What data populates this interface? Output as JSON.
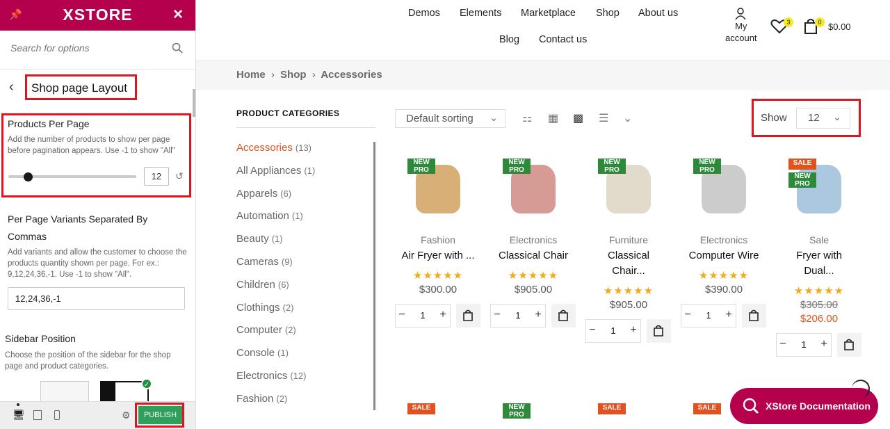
{
  "panel": {
    "logo": "XSTORE",
    "search_placeholder": "Search for options",
    "section_title": "Shop page Layout",
    "products_per_page": {
      "label": "Products Per Page",
      "desc1": "Add the number of products to show per page",
      "desc2": "before pagination appears. Use -1 to show \"All\"",
      "value": "12",
      "slider_fraction": 0.15
    },
    "variants": {
      "label1": "Per Page Variants Separated By",
      "label2": "Commas",
      "desc1": "Add variants and allow the customer to choose the",
      "desc2": "products quantity shown per page. For ex.:",
      "desc3": "9,12,24,36,-1. Use -1 to show \"All\".",
      "value": "12,24,36,-1"
    },
    "sidebar_position": {
      "label": "Sidebar Position",
      "desc1": "Choose the position of the sidebar for the shop",
      "desc2": "page and product categories."
    },
    "publish_label": "PUBLISH"
  },
  "nav": {
    "items": [
      "Demos",
      "Elements",
      "Marketplace",
      "Shop",
      "About us",
      "Blog",
      "Contact us"
    ],
    "account_line1": "My",
    "account_line2": "account",
    "wishlist_count": "3",
    "cart_count": "0",
    "cart_total": "$0.00"
  },
  "breadcrumb": {
    "home": "Home",
    "shop": "Shop",
    "current": "Accessories",
    "sep": "›"
  },
  "categories": {
    "title": "PRODUCT CATEGORIES",
    "items": [
      {
        "name": "Accessories",
        "count": "(13)"
      },
      {
        "name": "All Appliances",
        "count": "(1)"
      },
      {
        "name": "Apparels",
        "count": "(6)"
      },
      {
        "name": "Automation",
        "count": "(1)"
      },
      {
        "name": "Beauty",
        "count": "(1)"
      },
      {
        "name": "Cameras",
        "count": "(9)"
      },
      {
        "name": "Children",
        "count": "(6)"
      },
      {
        "name": "Clothings",
        "count": "(2)"
      },
      {
        "name": "Computer",
        "count": "(2)"
      },
      {
        "name": "Console",
        "count": "(1)"
      },
      {
        "name": "Electronics",
        "count": "(12)"
      },
      {
        "name": "Fashion",
        "count": "(2)"
      }
    ]
  },
  "toolbar": {
    "sort": "Default sorting",
    "show_label": "Show",
    "show_value": "12"
  },
  "products": [
    {
      "tag1": "NEW PRO",
      "tag2": "",
      "category": "Fashion",
      "name1": "Air Fryer with ...",
      "name2": "",
      "price": "$300.00",
      "old_price": "",
      "qty": "1",
      "stars": "★★★★★"
    },
    {
      "tag1": "NEW PRO",
      "tag2": "",
      "category": "Electronics",
      "name1": "Classical Chair",
      "name2": "",
      "price": "$905.00",
      "old_price": "",
      "qty": "1",
      "stars": "★★★★★"
    },
    {
      "tag1": "NEW PRO",
      "tag2": "",
      "category": "Furniture",
      "name1": "Classical",
      "name2": "Chair...",
      "price": "$905.00",
      "old_price": "",
      "qty": "1",
      "stars": "★★★★★"
    },
    {
      "tag1": "NEW PRO",
      "tag2": "",
      "category": "Electronics",
      "name1": "Computer Wire",
      "name2": "",
      "price": "$390.00",
      "old_price": "",
      "qty": "1",
      "stars": "★★★★★"
    },
    {
      "tag1": "SALE",
      "tag2": "NEW PRO",
      "category": "Sale",
      "name1": "Fryer with",
      "name2": "Dual...",
      "price": "$206.00",
      "old_price": "$305.00",
      "qty": "1",
      "stars": "★★★★★"
    }
  ],
  "bottom_tags": [
    "SALE",
    "NEW PRO",
    "SALE",
    "SALE"
  ],
  "doc_button": "XStore Documentation",
  "colors": {
    "brand": "#b5004e",
    "accent": "#e0521f",
    "new_tag": "#2e8a3a",
    "stars": "#f2a91b",
    "highlight": "#e0141e",
    "publish": "#2fa05b"
  }
}
